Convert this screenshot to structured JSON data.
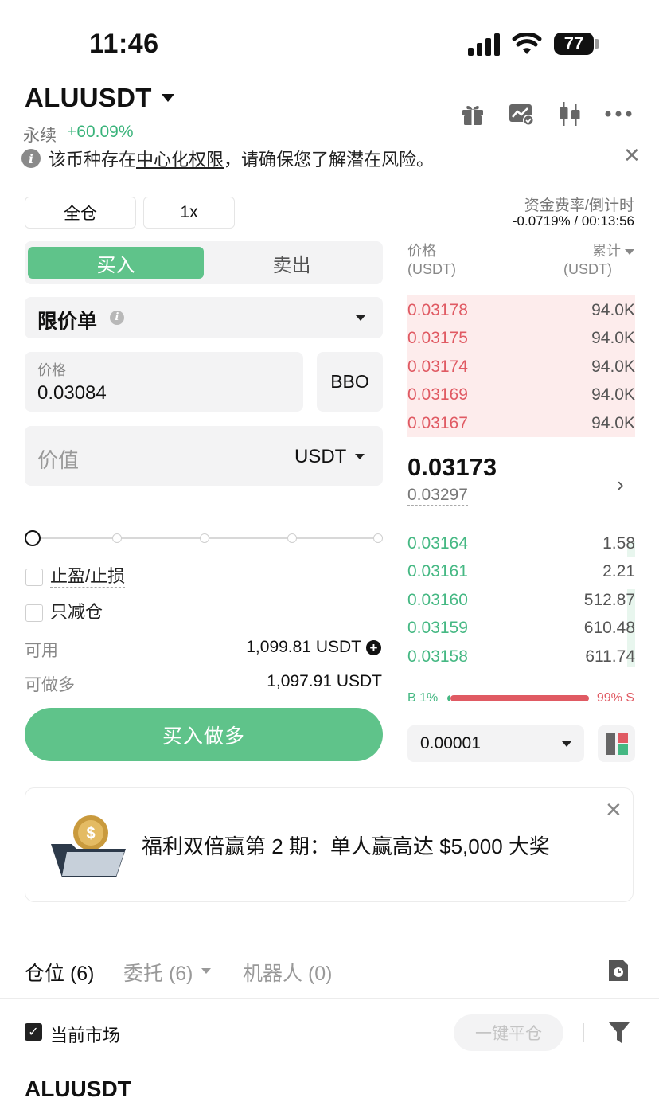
{
  "status_bar": {
    "time": "11:46",
    "battery": "77"
  },
  "header": {
    "pair": "ALUUSDT",
    "contract_type": "永续",
    "change": "+60.09%",
    "icons": [
      "gift-icon",
      "chart-check-icon",
      "candlestick-icon",
      "more-icon"
    ]
  },
  "notice": {
    "prefix": "该币种存在",
    "link": "中心化权限",
    "suffix": "，请确保您了解潜在风险。"
  },
  "leverage": {
    "margin_mode": "全仓",
    "multiplier": "1x"
  },
  "funding": {
    "label": "资金费率/倒计时",
    "value": "-0.0719% / 00:13:56"
  },
  "trade": {
    "buy_tab": "买入",
    "sell_tab": "卖出",
    "order_type": "限价单",
    "price_label": "价格",
    "price_value": "0.03084",
    "bbo": "BBO",
    "value_placeholder": "价值",
    "value_unit": "USDT",
    "tp_sl": "止盈/止损",
    "reduce_only": "只减仓",
    "available_label": "可用",
    "available_value": "1,099.81 USDT",
    "max_long_label": "可做多",
    "max_long_value": "1,097.91 USDT",
    "submit": "买入做多",
    "slider_percent": 0
  },
  "order_book": {
    "price_header": "价格",
    "price_unit": "(USDT)",
    "total_header": "累计",
    "total_unit": "(USDT)",
    "asks": [
      {
        "price": "0.03178",
        "qty": "94.0K"
      },
      {
        "price": "0.03175",
        "qty": "94.0K"
      },
      {
        "price": "0.03174",
        "qty": "94.0K"
      },
      {
        "price": "0.03169",
        "qty": "94.0K"
      },
      {
        "price": "0.03167",
        "qty": "94.0K"
      }
    ],
    "last_price": "0.03173",
    "mark_price": "0.03297",
    "bids": [
      {
        "price": "0.03164",
        "qty": "1.58"
      },
      {
        "price": "0.03161",
        "qty": "2.21"
      },
      {
        "price": "0.03160",
        "qty": "512.87"
      },
      {
        "price": "0.03159",
        "qty": "610.48"
      },
      {
        "price": "0.03158",
        "qty": "611.74"
      }
    ],
    "buy_ratio": "B 1%",
    "sell_ratio": "99% S",
    "precision": "0.00001"
  },
  "promo": {
    "text": "福利双倍赢第 2 期：单人赢高达 $5,000 大奖"
  },
  "tabs": {
    "positions": "仓位 (6)",
    "orders": "委托 (6)",
    "bots": "机器人 (0)"
  },
  "filters": {
    "current_market": "当前市场",
    "close_all": "一键平仓"
  },
  "position": {
    "symbol": "ALUUSDT"
  },
  "colors": {
    "green": "#5fc38a",
    "red": "#e05a63",
    "ask_bg": "#fdecec"
  }
}
